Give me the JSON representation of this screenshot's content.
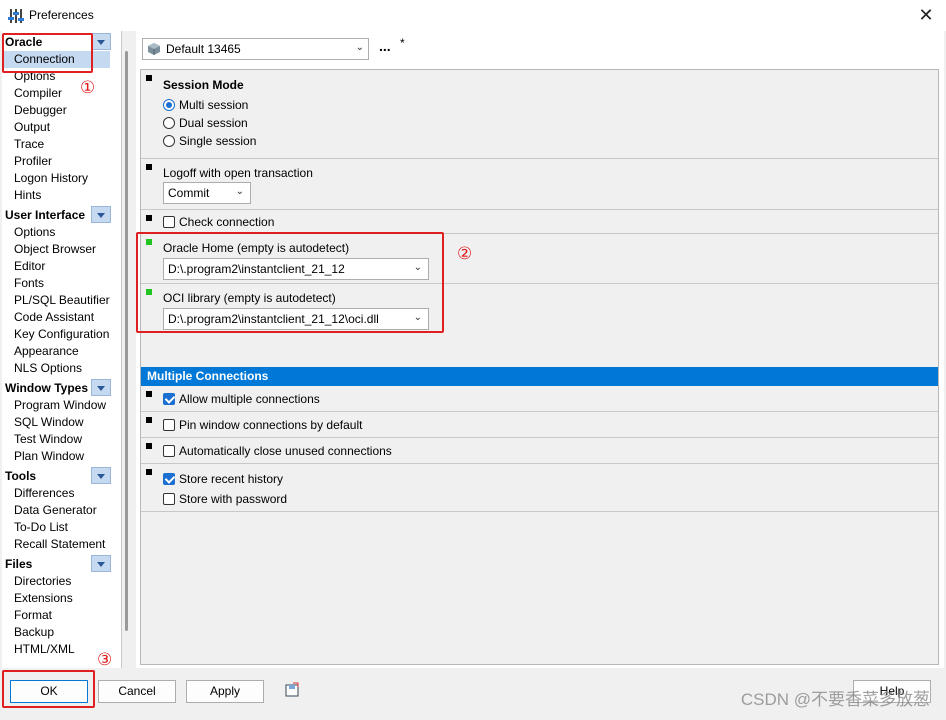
{
  "window": {
    "title": "Preferences",
    "close_icon": "close-icon"
  },
  "sidebar": {
    "categories": [
      {
        "label": "Oracle",
        "items": [
          "Connection",
          "Options",
          "Compiler",
          "Debugger",
          "Output",
          "Trace",
          "Profiler",
          "Logon History",
          "Hints"
        ]
      },
      {
        "label": "User Interface",
        "items": [
          "Options",
          "Object Browser",
          "Editor",
          "Fonts",
          "PL/SQL Beautifier",
          "Code Assistant",
          "Key Configuration",
          "Appearance",
          "NLS Options"
        ]
      },
      {
        "label": "Window Types",
        "items": [
          "Program Window",
          "SQL Window",
          "Test Window",
          "Plan Window"
        ]
      },
      {
        "label": "Tools",
        "items": [
          "Differences",
          "Data Generator",
          "To-Do List",
          "Recall Statement"
        ]
      },
      {
        "label": "Files",
        "items": [
          "Directories",
          "Extensions",
          "Format",
          "Backup",
          "HTML/XML"
        ]
      }
    ],
    "selected": "Connection"
  },
  "profile": {
    "value": "Default 13465",
    "dots": "...",
    "star": "*"
  },
  "session": {
    "title": "Session Mode",
    "options": [
      "Multi session",
      "Dual session",
      "Single session"
    ],
    "selected": "Multi session"
  },
  "logoff": {
    "label": "Logoff with open transaction",
    "value": "Commit"
  },
  "check_connection": {
    "label": "Check connection",
    "checked": false
  },
  "oracle_home": {
    "label": "Oracle Home (empty is autodetect)",
    "value": "D:\\.program2\\instantclient_21_12"
  },
  "oci_library": {
    "label": "OCI library (empty is autodetect)",
    "value": "D:\\.program2\\instantclient_21_12\\oci.dll"
  },
  "multiple_connections": {
    "header": "Multiple Connections",
    "allow": {
      "label": "Allow multiple connections",
      "checked": true
    },
    "pin": {
      "label": "Pin window connections by default",
      "checked": false
    },
    "auto_close": {
      "label": "Automatically close unused connections",
      "checked": false
    },
    "store_history": {
      "label": "Store recent history",
      "checked": true
    },
    "store_password": {
      "label": "Store with password",
      "checked": false
    }
  },
  "buttons": {
    "ok": "OK",
    "cancel": "Cancel",
    "apply": "Apply",
    "help": "Help"
  },
  "annotations": {
    "n1": "①",
    "n2": "②",
    "n3": "③"
  },
  "watermark": "CSDN @不要香菜多放葱",
  "colors": {
    "accent": "#0078d7",
    "annotation": "#e02020",
    "selected_bg": "#c5d9f0"
  }
}
